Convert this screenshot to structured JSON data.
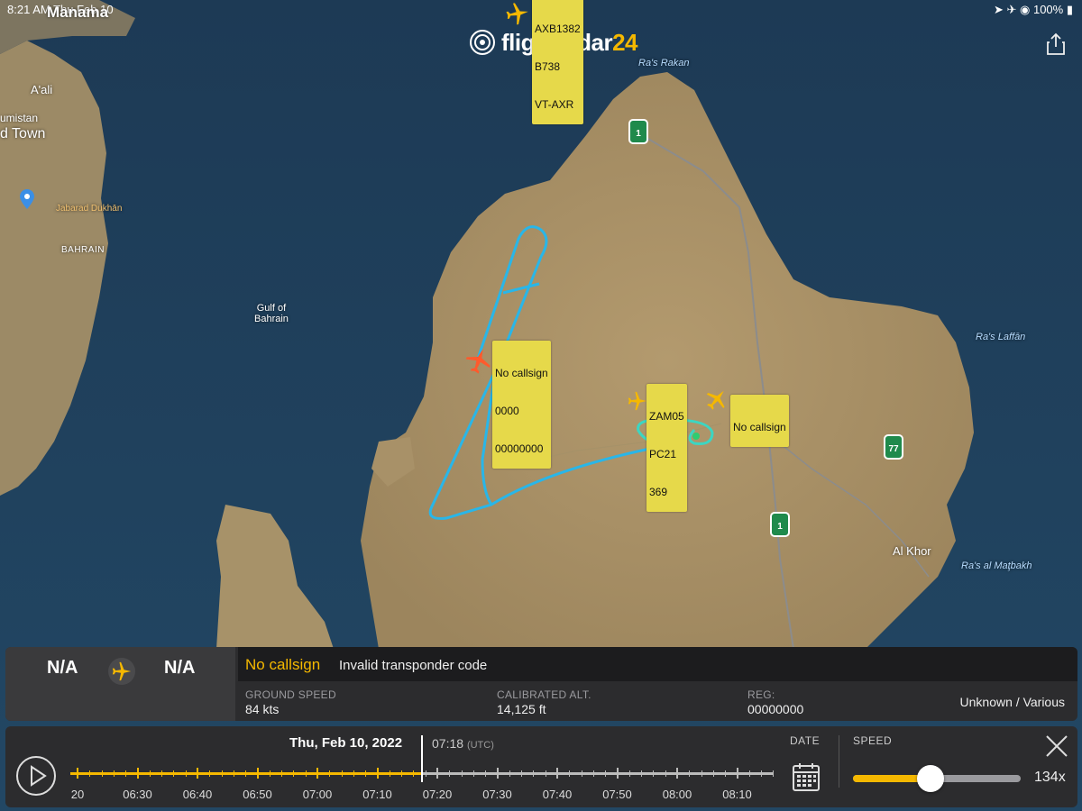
{
  "status_bar": {
    "time_date": "8:21 AM   Thu Feb 10",
    "battery": "100%"
  },
  "app": {
    "logo_name": "flightradar",
    "logo_num": "24"
  },
  "map": {
    "places": {
      "manama": "Manama",
      "aali": "A'ali",
      "umistan": "umistan",
      "town": "d Town",
      "jabarad": "Jabarad Dukhān",
      "bahrain": "BAHRAIN",
      "gulf": "Gulf of\nBahrain",
      "ras_rakan": "Ra's Rakan",
      "ras_laffan": "Ra's Laffān",
      "al_khor": "Al Khor",
      "ras_matbakh": "Ra's al Maţbakh"
    },
    "shields": {
      "r1": "1",
      "r77": "77",
      "r1b": "1"
    },
    "aircraft": [
      {
        "id": "top",
        "lines": [
          "AXB1382",
          "B738",
          "VT-AXR"
        ]
      },
      {
        "id": "selected",
        "lines": [
          "No callsign",
          "0000",
          "00000000"
        ]
      },
      {
        "id": "zam",
        "lines": [
          "ZAM05",
          "PC21",
          "369"
        ]
      },
      {
        "id": "right",
        "lines": [
          "No callsign"
        ]
      }
    ],
    "colors": {
      "selected_plane": "#ff5a2c",
      "plane": "#f5b800",
      "track": "#29b6e8",
      "tag_bg": "#e6d94a"
    }
  },
  "flight_panel": {
    "origin": "N/A",
    "destination": "N/A",
    "callsign": "No callsign",
    "transponder": "Invalid transponder code",
    "ground_speed_label": "GROUND SPEED",
    "ground_speed": "84 kts",
    "calibrated_alt_label": "CALIBRATED ALT.",
    "calibrated_alt": "14,125 ft",
    "reg_label": "REG:",
    "reg": "00000000",
    "type": "Unknown / Various"
  },
  "timeline": {
    "date": "Thu, Feb 10, 2022",
    "time": "07:18",
    "tz": "(UTC)",
    "labels": [
      "20",
      "06:30",
      "06:40",
      "06:50",
      "07:00",
      "07:10",
      "07:20",
      "07:30",
      "07:40",
      "07:50",
      "08:00",
      "08:10"
    ],
    "progress": 0.5,
    "date_label": "DATE",
    "speed_label": "SPEED",
    "speed": "134x",
    "speed_fraction": 0.46
  }
}
